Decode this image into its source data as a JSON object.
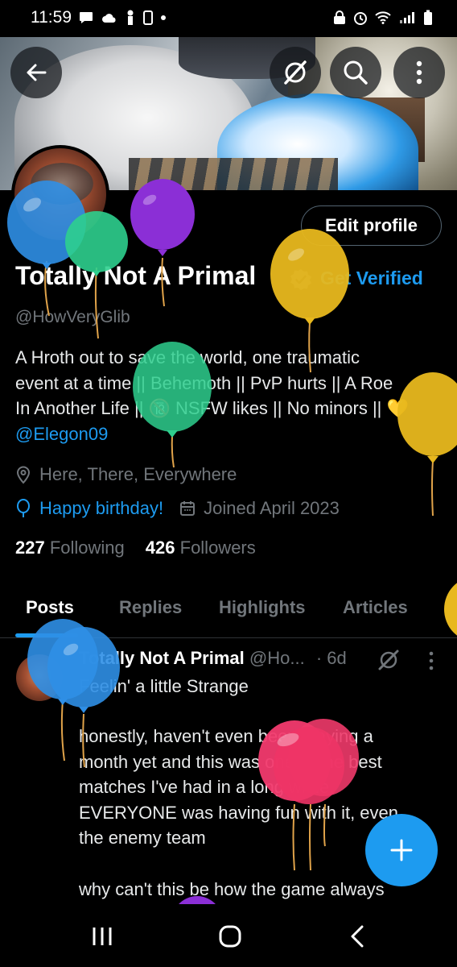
{
  "status_bar": {
    "time": "11:59"
  },
  "profile": {
    "name": "Totally Not A Primal",
    "get_verified": "Get Verified",
    "handle": "@HowVeryGlib",
    "edit_profile": "Edit profile",
    "bio_lines": [
      "A Hroth out to save the world, one traumatic",
      "event at a time || Behemoth || PvP hurts || A Roe",
      "In Another Life || 🔞 NSFW likes || No minors || 💛"
    ],
    "bio_link": "@Elegon09",
    "location": "Here, There, Everywhere",
    "birthday": "Happy birthday!",
    "joined": "Joined April 2023",
    "following_count": "227",
    "following_label": "Following",
    "followers_count": "426",
    "followers_label": "Followers"
  },
  "tabs": [
    "Posts",
    "Replies",
    "Highlights",
    "Articles"
  ],
  "post": {
    "author": "Totally Not A Primal",
    "handle": "@Ho...",
    "time": "· 6d",
    "line1": "Feelin' a little Strange",
    "body_lines": [
      "honestly, haven't even been playing a",
      "month yet and this was one of the best",
      "matches I've had in a long while.",
      "EVERYONE was having fun with it, even",
      "the enemy team"
    ],
    "line_last": "why can't this be how the game always"
  },
  "colors": {
    "accent": "#1d9bf0",
    "background": "#000000",
    "muted": "#71767b"
  }
}
